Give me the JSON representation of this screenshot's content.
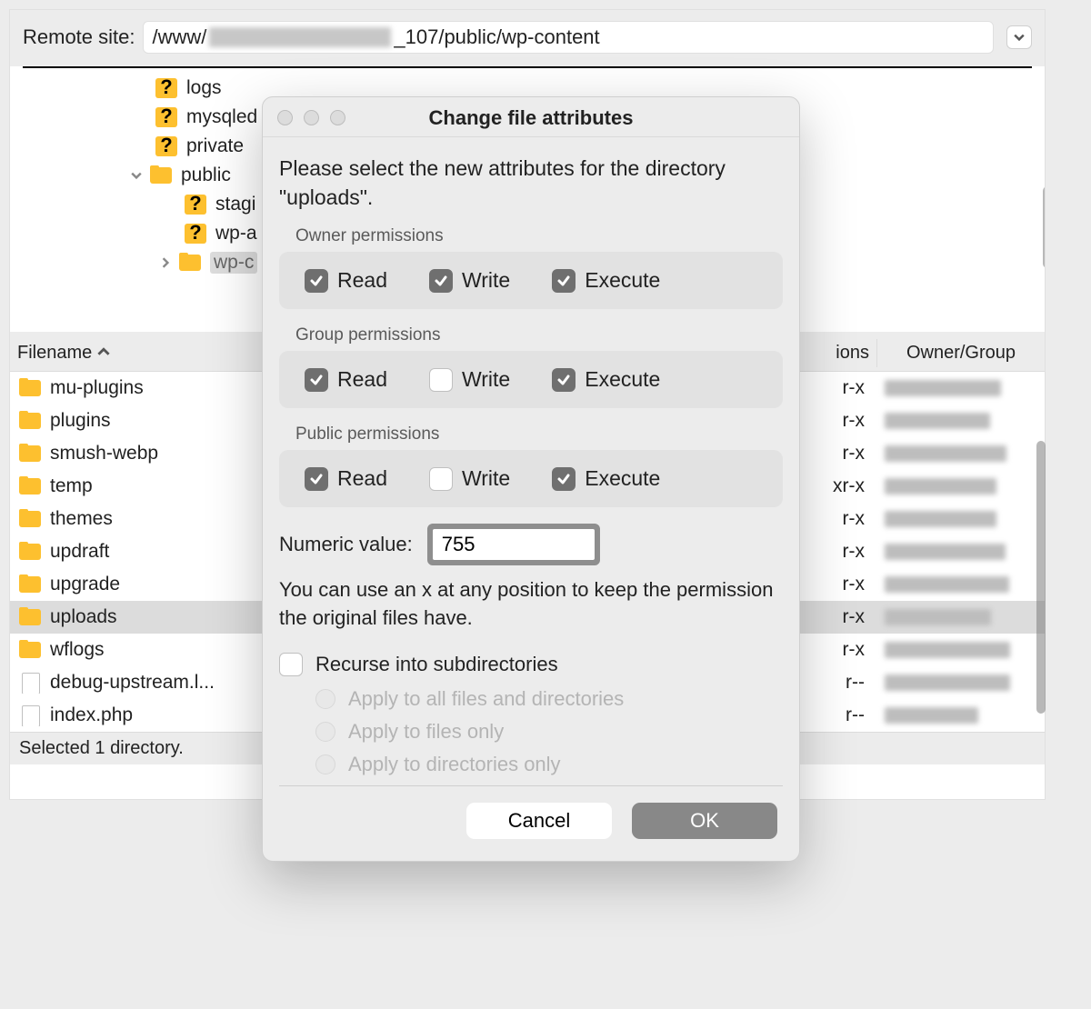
{
  "remote": {
    "label": "Remote site:",
    "path_prefix": "/www/",
    "path_suffix": "_107/public/wp-content"
  },
  "tree": [
    {
      "indent": 160,
      "icon": "q",
      "label": "logs"
    },
    {
      "indent": 160,
      "icon": "q",
      "label": "mysqled"
    },
    {
      "indent": 160,
      "icon": "q",
      "label": "private"
    },
    {
      "indent": 130,
      "icon": "folder",
      "label": "public",
      "expander": "down"
    },
    {
      "indent": 192,
      "icon": "q",
      "label": "stagi"
    },
    {
      "indent": 192,
      "icon": "q",
      "label": "wp-a"
    },
    {
      "indent": 162,
      "icon": "folder",
      "label": "wp-c",
      "expander": "right",
      "selected": true
    }
  ],
  "list_header": {
    "filename": "Filename",
    "permissions_tail": "ions",
    "owner": "Owner/Group"
  },
  "list": [
    {
      "icon": "folder",
      "name": "mu-plugins",
      "perm_tail": "r-x",
      "sel": false
    },
    {
      "icon": "folder",
      "name": "plugins",
      "perm_tail": "r-x",
      "sel": false
    },
    {
      "icon": "folder",
      "name": "smush-webp",
      "perm_tail": "r-x",
      "sel": false
    },
    {
      "icon": "folder",
      "name": "temp",
      "perm_tail": "xr-x",
      "sel": false
    },
    {
      "icon": "folder",
      "name": "themes",
      "perm_tail": "r-x",
      "sel": false
    },
    {
      "icon": "folder",
      "name": "updraft",
      "perm_tail": "r-x",
      "sel": false
    },
    {
      "icon": "folder",
      "name": "upgrade",
      "perm_tail": "r-x",
      "sel": false
    },
    {
      "icon": "folder",
      "name": "uploads",
      "perm_tail": "r-x",
      "sel": true
    },
    {
      "icon": "folder",
      "name": "wflogs",
      "perm_tail": "r-x",
      "sel": false
    },
    {
      "icon": "file",
      "name": "debug-upstream.l...",
      "perm_tail": "r--",
      "sel": false
    },
    {
      "icon": "file",
      "name": "index.php",
      "perm_tail": "r--",
      "sel": false
    }
  ],
  "status": "Selected 1 directory.",
  "dialog": {
    "title": "Change file attributes",
    "instructions": "Please select the new attributes for the directory \"uploads\".",
    "owner_label": "Owner permissions",
    "group_label": "Group permissions",
    "public_label": "Public permissions",
    "read": "Read",
    "write": "Write",
    "execute": "Execute",
    "owner": {
      "read": true,
      "write": true,
      "execute": true
    },
    "group": {
      "read": true,
      "write": false,
      "execute": true
    },
    "public": {
      "read": true,
      "write": false,
      "execute": true
    },
    "numeric_label": "Numeric value:",
    "numeric_value": "755",
    "hint": "You can use an x at any position to keep the permission the original files have.",
    "recurse_label": "Recurse into subdirectories",
    "recurse_checked": false,
    "radio_all": "Apply to all files and directories",
    "radio_files": "Apply to files only",
    "radio_dirs": "Apply to directories only",
    "cancel": "Cancel",
    "ok": "OK"
  }
}
